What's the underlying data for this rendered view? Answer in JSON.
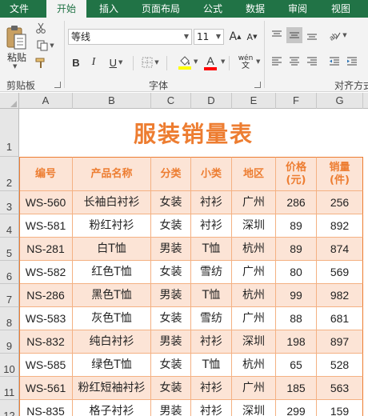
{
  "tabs": [
    {
      "label": "文件",
      "active": false
    },
    {
      "label": "开始",
      "active": true
    },
    {
      "label": "插入",
      "active": false
    },
    {
      "label": "页面布局",
      "active": false
    },
    {
      "label": "公式",
      "active": false
    },
    {
      "label": "数据",
      "active": false
    },
    {
      "label": "审阅",
      "active": false
    },
    {
      "label": "视图",
      "active": false
    }
  ],
  "ribbon": {
    "clipboard": {
      "paste_label": "粘贴",
      "group_label": "剪贴板"
    },
    "font": {
      "font_name": "等线",
      "font_size": "11",
      "bold_label": "B",
      "italic_label": "I",
      "underline_label": "U",
      "grow_label": "A",
      "shrink_label": "A",
      "font_color_label": "A",
      "phonetic_label": "wén",
      "group_label": "字体",
      "highlight_color": "#ffff00",
      "font_color": "#ff0000"
    },
    "alignment": {
      "group_label": "对齐方式"
    }
  },
  "sheet": {
    "columns": [
      "A",
      "B",
      "C",
      "D",
      "E",
      "F",
      "G"
    ],
    "row_numbers": [
      "1",
      "2",
      "3",
      "4",
      "5",
      "6",
      "7",
      "8",
      "9",
      "10",
      "11",
      "12"
    ],
    "title": "服装销量表",
    "headers": [
      "编号",
      "产品名称",
      "分类",
      "小类",
      "地区",
      "价格\n(元)",
      "销量\n(件)"
    ],
    "rows": [
      [
        "WS-560",
        "长袖白衬衫",
        "女装",
        "衬衫",
        "广州",
        "286",
        "256"
      ],
      [
        "WS-581",
        "粉红衬衫",
        "女装",
        "衬衫",
        "深圳",
        "89",
        "892"
      ],
      [
        "NS-281",
        "白T恤",
        "男装",
        "T恤",
        "杭州",
        "89",
        "874"
      ],
      [
        "WS-582",
        "红色T恤",
        "女装",
        "雪纺",
        "广州",
        "80",
        "569"
      ],
      [
        "NS-286",
        "黑色T恤",
        "男装",
        "T恤",
        "杭州",
        "99",
        "982"
      ],
      [
        "WS-583",
        "灰色T恤",
        "女装",
        "雪纺",
        "广州",
        "88",
        "681"
      ],
      [
        "NS-832",
        "纯白衬衫",
        "男装",
        "衬衫",
        "深圳",
        "198",
        "897"
      ],
      [
        "WS-585",
        "绿色T恤",
        "女装",
        "T恤",
        "杭州",
        "65",
        "528"
      ],
      [
        "WS-561",
        "粉红短袖衬衫",
        "女装",
        "衬衫",
        "广州",
        "185",
        "563"
      ],
      [
        "NS-835",
        "格子衬衫",
        "男装",
        "衬衫",
        "深圳",
        "299",
        "159"
      ]
    ],
    "colors": {
      "accent": "#ed7d31",
      "band": "#fce4d6",
      "border": "#f4b183"
    }
  }
}
